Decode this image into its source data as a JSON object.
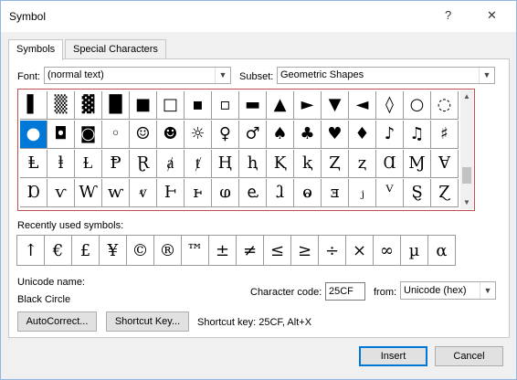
{
  "window": {
    "title": "Symbol",
    "help_glyph": "?",
    "close_glyph": "✕"
  },
  "tabs": [
    {
      "label": "Symbols",
      "active": true
    },
    {
      "label": "Special Characters",
      "active": false
    }
  ],
  "font": {
    "label": "Font:",
    "value": "(normal text)"
  },
  "subset": {
    "label": "Subset:",
    "value": "Geometric Shapes"
  },
  "symbol_grid": {
    "selected_index": 16,
    "rows": [
      [
        "▌",
        "▒",
        "▓",
        "█",
        "■",
        "□",
        "▪",
        "▫",
        "▬",
        "▲",
        "►",
        "▼",
        "◄",
        "◊",
        "○",
        "◌"
      ],
      [
        "●",
        "◘",
        "◙",
        "◦",
        "☺",
        "☻",
        "☼",
        "♀",
        "♂",
        "♠",
        "♣",
        "♥",
        "♦",
        "♪",
        "♫",
        "♯"
      ],
      [
        "Ⱡ",
        "ⱡ",
        "Ɫ",
        "Ᵽ",
        "Ɽ",
        "ⱥ",
        "ⱦ",
        "Ⱨ",
        "ⱨ",
        "Ⱪ",
        "ⱪ",
        "Ⱬ",
        "ⱬ",
        "Ɑ",
        "Ɱ",
        "Ɐ"
      ],
      [
        "Ɒ",
        "ⱱ",
        "Ⱳ",
        "ⱳ",
        "ⱴ",
        "Ⱶ",
        "ⱶ",
        "ⱷ",
        "ⱸ",
        "ⱹ",
        "ⱺ",
        "ⱻ",
        "ⱼ",
        "ⱽ",
        "Ȿ",
        "Ɀ"
      ]
    ]
  },
  "recent": {
    "label": "Recently used symbols:",
    "symbols": [
      "↑",
      "€",
      "£",
      "¥",
      "©",
      "®",
      "™",
      "±",
      "≠",
      "≤",
      "≥",
      "÷",
      "×",
      "∞",
      "µ",
      "α"
    ]
  },
  "unicode_name": {
    "label": "Unicode name:",
    "value": "Black Circle"
  },
  "character_code": {
    "label": "Character code:",
    "value": "25CF"
  },
  "from": {
    "label": "from:",
    "value": "Unicode (hex)"
  },
  "buttons": {
    "autocorrect": "AutoCorrect...",
    "shortcut_key": "Shortcut Key...",
    "insert": "Insert",
    "cancel": "Cancel"
  },
  "shortcut_text": "Shortcut key: 25CF, Alt+X",
  "icons": {
    "dropdown": "chevron-down-icon",
    "scroll_up": "chevron-up-icon",
    "scroll_down": "chevron-down-icon"
  }
}
